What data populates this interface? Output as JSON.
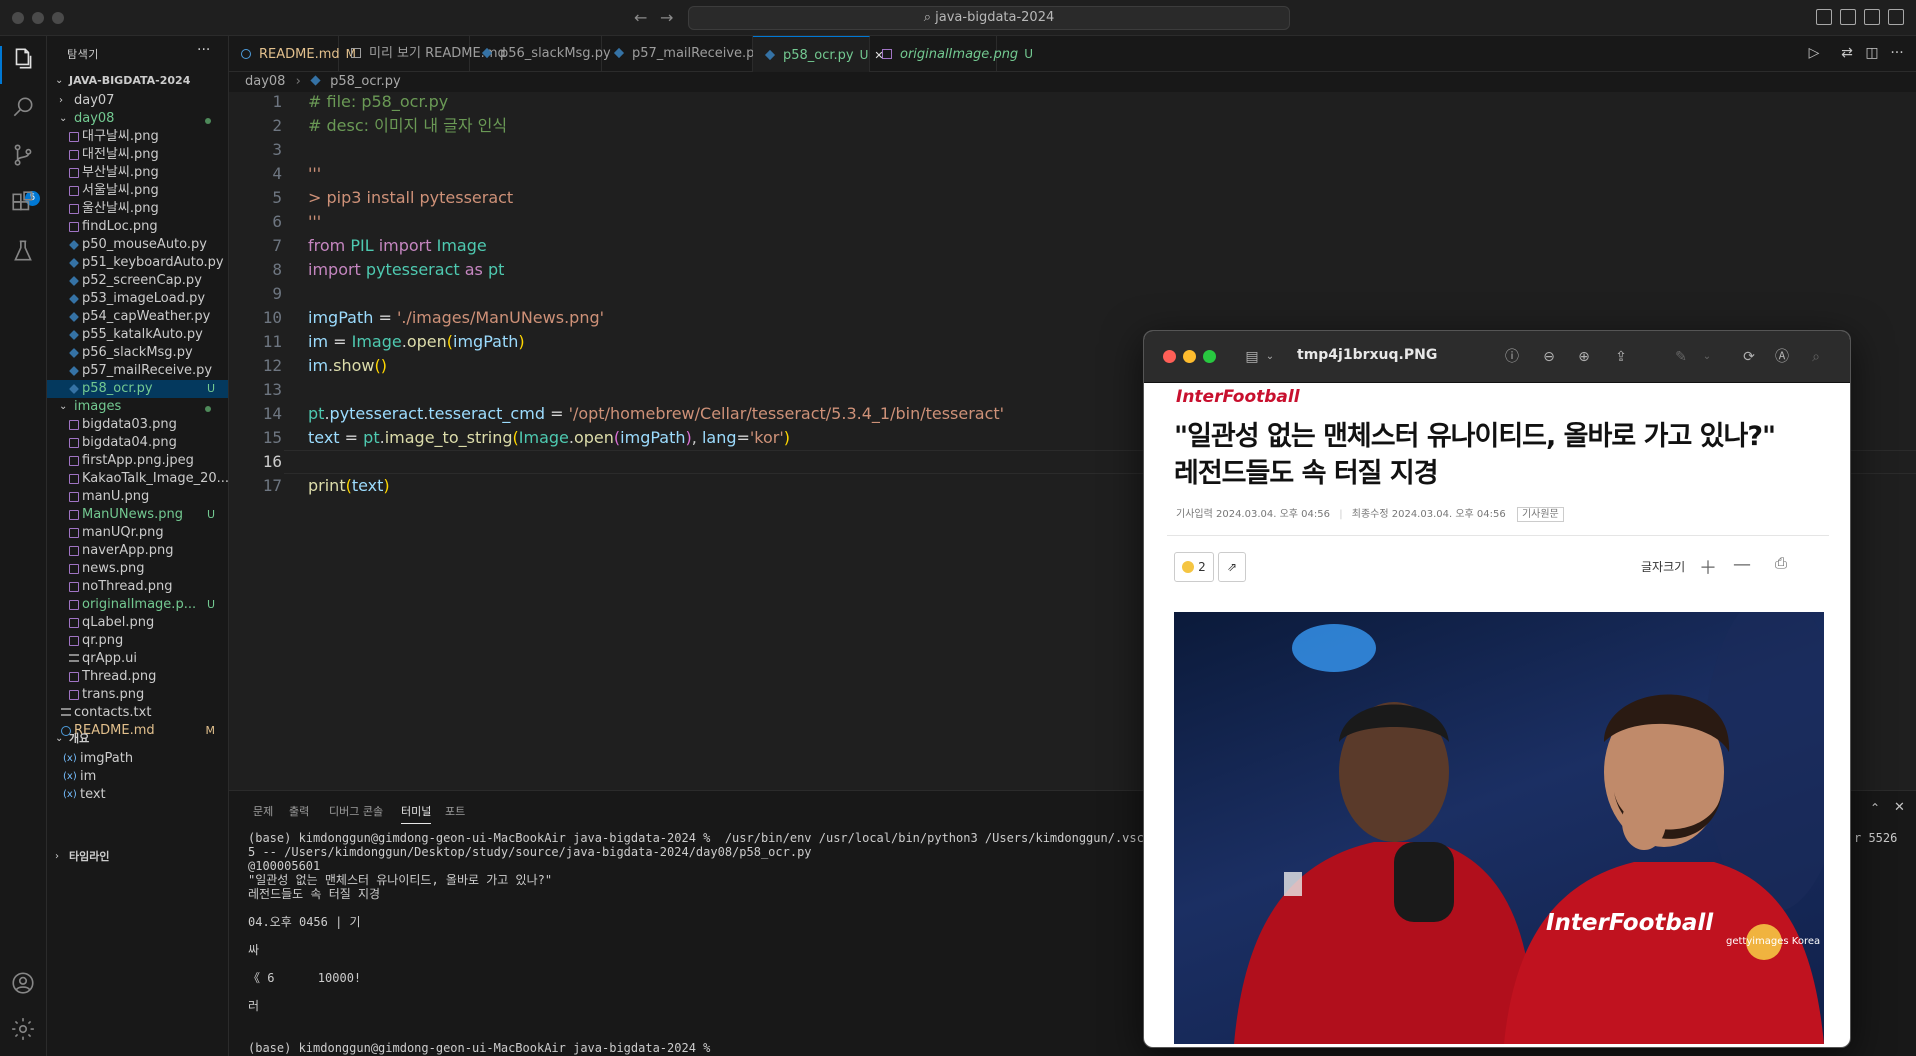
{
  "titlebar": {
    "search_label": "⌕ java-bigdata-2024"
  },
  "sidebar": {
    "title": "탐색기",
    "root": "JAVA-BIGDATA-2024",
    "items": [
      {
        "label": "day07",
        "type": "folder",
        "depth": 0,
        "open": false
      },
      {
        "label": "day08",
        "type": "folder",
        "depth": 0,
        "open": true,
        "dot": true
      },
      {
        "label": "대구날씨.png",
        "type": "img",
        "depth": 1
      },
      {
        "label": "대전날씨.png",
        "type": "img",
        "depth": 1
      },
      {
        "label": "부산날씨.png",
        "type": "img",
        "depth": 1
      },
      {
        "label": "서울날씨.png",
        "type": "img",
        "depth": 1
      },
      {
        "label": "울산날씨.png",
        "type": "img",
        "depth": 1
      },
      {
        "label": "findLoc.png",
        "type": "img",
        "depth": 1
      },
      {
        "label": "p50_mouseAuto.py",
        "type": "py",
        "depth": 1
      },
      {
        "label": "p51_keyboardAuto.py",
        "type": "py",
        "depth": 1
      },
      {
        "label": "p52_screenCap.py",
        "type": "py",
        "depth": 1
      },
      {
        "label": "p53_imageLoad.py",
        "type": "py",
        "depth": 1
      },
      {
        "label": "p54_capWeather.py",
        "type": "py",
        "depth": 1
      },
      {
        "label": "p55_katalkAuto.py",
        "type": "py",
        "depth": 1
      },
      {
        "label": "p56_slackMsg.py",
        "type": "py",
        "depth": 1
      },
      {
        "label": "p57_mailReceive.py",
        "type": "py",
        "depth": 1
      },
      {
        "label": "p58_ocr.py",
        "type": "py",
        "depth": 1,
        "status": "U",
        "selected": true
      },
      {
        "label": "images",
        "type": "folder",
        "depth": 0,
        "open": true,
        "dot": true
      },
      {
        "label": "bigdata03.png",
        "type": "img",
        "depth": 1
      },
      {
        "label": "bigdata04.png",
        "type": "img",
        "depth": 1
      },
      {
        "label": "firstApp.png.jpeg",
        "type": "img",
        "depth": 1
      },
      {
        "label": "KakaoTalk_Image_20...",
        "type": "img",
        "depth": 1
      },
      {
        "label": "manU.png",
        "type": "img",
        "depth": 1
      },
      {
        "label": "ManUNews.png",
        "type": "img",
        "depth": 1,
        "status": "U"
      },
      {
        "label": "manUQr.png",
        "type": "img",
        "depth": 1
      },
      {
        "label": "naverApp.png",
        "type": "img",
        "depth": 1
      },
      {
        "label": "news.png",
        "type": "img",
        "depth": 1
      },
      {
        "label": "noThread.png",
        "type": "img",
        "depth": 1
      },
      {
        "label": "originalImage.p...",
        "type": "img",
        "depth": 1,
        "status": "U"
      },
      {
        "label": "qLabel.png",
        "type": "img",
        "depth": 1
      },
      {
        "label": "qr.png",
        "type": "img",
        "depth": 1
      },
      {
        "label": "qrApp.ui",
        "type": "txt",
        "depth": 1
      },
      {
        "label": "Thread.png",
        "type": "img",
        "depth": 1
      },
      {
        "label": "trans.png",
        "type": "img",
        "depth": 1
      },
      {
        "label": "contacts.txt",
        "type": "txt",
        "depth": 0
      },
      {
        "label": "README.md",
        "type": "md",
        "depth": 0,
        "status": "M"
      }
    ],
    "outline_title": "개요",
    "outline_items": [
      "imgPath",
      "im",
      "text"
    ],
    "timeline_title": "타임라인"
  },
  "tabs": [
    {
      "label": "README.md",
      "status": "M",
      "kind": "md"
    },
    {
      "label": "미리 보기 README.md",
      "status": "",
      "kind": "preview"
    },
    {
      "label": "p56_slackMsg.py",
      "status": "",
      "kind": "py"
    },
    {
      "label": "p57_mailReceive.py",
      "status": "",
      "kind": "py"
    },
    {
      "label": "p58_ocr.py",
      "status": "U",
      "kind": "py",
      "active": true
    },
    {
      "label": "originalImage.png",
      "status": "U",
      "kind": "img"
    }
  ],
  "breadcrumb": {
    "folder": "day08",
    "file": "p58_ocr.py"
  },
  "editor": {
    "line_numbers": [
      "1",
      "2",
      "3",
      "4",
      "5",
      "6",
      "7",
      "8",
      "9",
      "10",
      "11",
      "12",
      "13",
      "14",
      "15",
      "16",
      "17"
    ],
    "current_line": "16"
  },
  "panel": {
    "tabs": [
      "문제",
      "출력",
      "디버그 콘솔",
      "터미널",
      "포트"
    ],
    "active_tab": "터미널",
    "terminal_lines": [
      "(base) kimdonggun@gimdong-geon-ui-MacBookAir java-bigdata-2024 %  /usr/bin/env /usr/local/bin/python3 /Users/kimdonggun/.vscode/",
      "5 -- /Users/kimdonggun/Desktop/study/source/java-bigdata-2024/day08/p58_ocr.py",
      "@100005601",
      "\"일관성 없는 맨체스터 유나이티드, 올바로 가고 있나?\"",
      "레전드들도 속 터질 지경",
      "",
      "04.오후 0456 | 기",
      "",
      "싸",
      "",
      "《 6      10000!",
      "",
      "러",
      "",
      "",
      "(base) kimdonggun@gimdong-geon-ui-MacBookAir java-bigdata-2024 %"
    ],
    "right_fragment": "r 5526"
  },
  "preview": {
    "title": "tmp4j1brxuq.PNG",
    "logo": "InterFootball",
    "headline_1": "\"일관성 없는 맨체스터 유나이티드, 올바로 가고 있나?\"",
    "headline_2": "레전드들도 속 터질 지경",
    "meta_input": "기사입력 2024.03.04. 오후 04:56",
    "meta_edit": "최종수정 2024.03.04. 오후 04:56",
    "meta_original": "기사원문",
    "reaction_count": "2",
    "font_size_label": "글자크기",
    "photo_logo": "InterFootball",
    "photo_credit": "gettyimages Korea"
  },
  "colors": {
    "accent": "#0078d4",
    "untracked": "#73c991",
    "modified": "#e2c08d",
    "logo_red": "#c8102e"
  }
}
